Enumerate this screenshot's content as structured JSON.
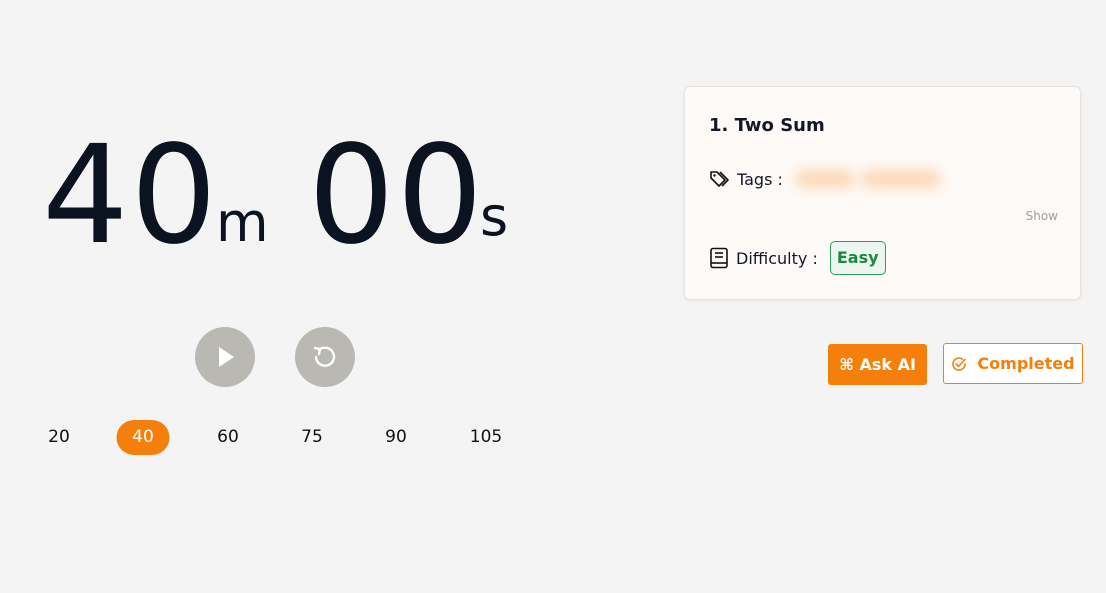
{
  "timer": {
    "minutes": "40",
    "minutes_unit": "m",
    "seconds": "00",
    "seconds_unit": "s"
  },
  "controls": {
    "play_icon": "play-icon",
    "reset_icon": "reset-icon"
  },
  "presets": {
    "values": [
      "20",
      "40",
      "60",
      "75",
      "90",
      "105"
    ],
    "selected": "40"
  },
  "problem": {
    "title": "1. Two Sum",
    "tags_label": "Tags :",
    "show_label": "Show",
    "difficulty_label": "Difficulty :",
    "difficulty": "Easy"
  },
  "actions": {
    "ask_ai": "⌘ Ask AI",
    "completed": "Completed"
  },
  "colors": {
    "accent": "#f57f0b",
    "easy": "#1a8a43",
    "control_bg": "#b9b8b3"
  }
}
